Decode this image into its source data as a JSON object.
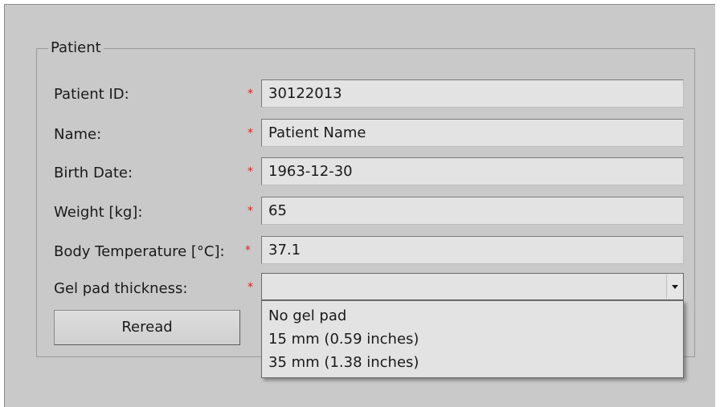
{
  "group": {
    "title": "Patient"
  },
  "fields": [
    {
      "label": "Patient ID:",
      "required_mark": "*",
      "value": "30122013"
    },
    {
      "label": "Name:",
      "required_mark": "*",
      "value": "Patient Name"
    },
    {
      "label": "Birth Date:",
      "required_mark": "*",
      "value": "1963-12-30"
    },
    {
      "label": "Weight [kg]:",
      "required_mark": "*",
      "value": "65"
    },
    {
      "label": "Body Temperature [°C]:",
      "required_mark": "*",
      "value": "37.1"
    }
  ],
  "gel_pad": {
    "label": "Gel pad thickness:",
    "required_mark": "*",
    "value": "",
    "options": [
      "No gel pad",
      "15 mm (0.59 inches)",
      "35 mm (1.38 inches)"
    ]
  },
  "buttons": {
    "reread": "Reread"
  },
  "colors": {
    "required": "#e02020",
    "panel_background": "#c9c9c9"
  },
  "icons": {
    "combo_arrow": "chevron-down-icon"
  }
}
